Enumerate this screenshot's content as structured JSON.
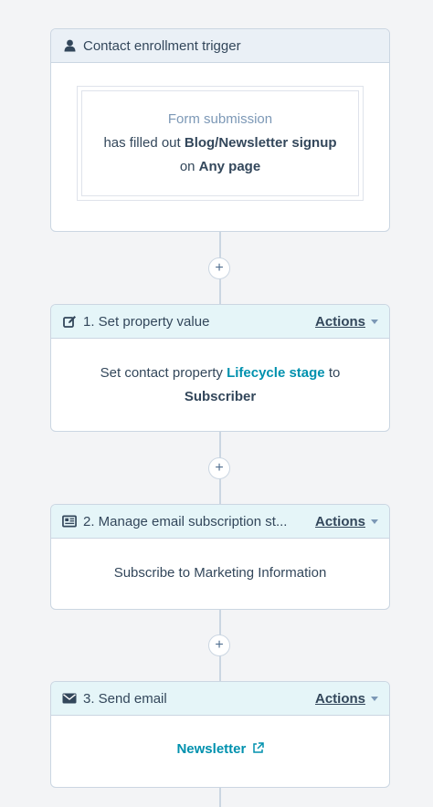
{
  "trigger": {
    "header": "Contact enrollment trigger",
    "icon": "person-icon",
    "filter_type": "Form submission",
    "line1_prefix": "has filled out",
    "line1_form": "Blog/Newsletter signup",
    "line2_prefix": "on",
    "line2_page": "Any page"
  },
  "add_button": "+",
  "actions_label": "Actions",
  "steps": [
    {
      "header": "1. Set property value",
      "icon": "edit-icon",
      "body_prefix": "Set contact property",
      "body_link": "Lifecycle stage",
      "body_suffix": "to",
      "body_value": "Subscriber"
    },
    {
      "header": "2. Manage email subscription st...",
      "icon": "newspaper-icon",
      "body": "Subscribe to Marketing Information"
    },
    {
      "header": "3. Send email",
      "icon": "envelope-icon",
      "body_link": "Newsletter",
      "link_icon": "external-link-icon"
    }
  ],
  "colors": {
    "accent_link": "#0091ae",
    "text": "#33475b",
    "border": "#cbd6e2",
    "trigger_header_bg": "#eaf0f6",
    "action_header_bg": "#e5f5f8"
  }
}
